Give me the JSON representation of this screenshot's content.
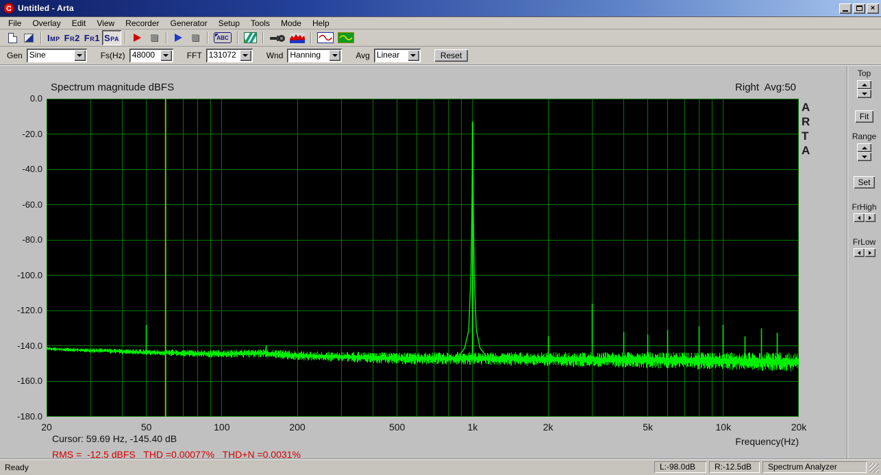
{
  "window": {
    "title": "Untitled - Arta"
  },
  "menu": {
    "items": [
      "File",
      "Overlay",
      "Edit",
      "View",
      "Recorder",
      "Generator",
      "Setup",
      "Tools",
      "Mode",
      "Help"
    ]
  },
  "toolbar": {
    "mode_buttons": [
      {
        "label": "Imp"
      },
      {
        "label": "Fr2"
      },
      {
        "label": "Fr1"
      },
      {
        "label": "Spa"
      }
    ],
    "abc_label": "ABC"
  },
  "controls": {
    "gen_label": "Gen",
    "gen_value": "Sine",
    "fs_label": "Fs(Hz)",
    "fs_value": "48000",
    "fft_label": "FFT",
    "fft_value": "131072",
    "wnd_label": "Wnd",
    "wnd_value": "Hanning",
    "avg_label": "Avg",
    "avg_value": "Linear",
    "reset_label": "Reset"
  },
  "graph": {
    "title": "Spectrum magnitude dBFS",
    "channel_avg": "Right  Avg:50",
    "watermark": "ARTA",
    "xlabel": "Frequency(Hz)",
    "cursor_readout": "Cursor: 59.69 Hz, -145.40 dB",
    "measurement_readout": "RMS =  -12.5 dBFS   THD =0.00077%   THD+N =0.0031%"
  },
  "side_panel": {
    "top": "Top",
    "fit": "Fit",
    "range": "Range",
    "set": "Set",
    "fr_high": "FrHigh",
    "fr_low": "FrLow"
  },
  "status_bar": {
    "ready": "Ready",
    "left_level": "L:-98.0dB",
    "right_level": "R:-12.5dB",
    "mode": "Spectrum Analyzer"
  },
  "chart_data": {
    "type": "line",
    "title": "Spectrum magnitude dBFS",
    "xlabel": "Frequency(Hz)",
    "ylabel": "dBFS",
    "x_scale": "log",
    "x_range": [
      20,
      20000
    ],
    "y_range": [
      -180,
      0
    ],
    "grid": true,
    "x_ticks": [
      {
        "f": 20,
        "label": "20"
      },
      {
        "f": 50,
        "label": "50"
      },
      {
        "f": 100,
        "label": "100"
      },
      {
        "f": 200,
        "label": "200"
      },
      {
        "f": 500,
        "label": "500"
      },
      {
        "f": 1000,
        "label": "1k"
      },
      {
        "f": 2000,
        "label": "2k"
      },
      {
        "f": 5000,
        "label": "5k"
      },
      {
        "f": 10000,
        "label": "10k"
      },
      {
        "f": 20000,
        "label": "20k"
      }
    ],
    "y_ticks": [
      {
        "v": 0,
        "label": "0.0"
      },
      {
        "v": -20,
        "label": "-20.0"
      },
      {
        "v": -40,
        "label": "-40.0"
      },
      {
        "v": -60,
        "label": "-60.0"
      },
      {
        "v": -80,
        "label": "-80.0"
      },
      {
        "v": -100,
        "label": "-100.0"
      },
      {
        "v": -120,
        "label": "-120.0"
      },
      {
        "v": -140,
        "label": "-140.0"
      },
      {
        "v": -160,
        "label": "-160.0"
      },
      {
        "v": -180,
        "label": "-180.0"
      }
    ],
    "cursor": {
      "freq_hz": 59.69,
      "level_dbfs": -145.4
    },
    "fundamental": {
      "freq_hz": 1000,
      "level_dbfs": -13
    },
    "harmonics_spurs": [
      {
        "f": 50,
        "db": -128
      },
      {
        "f": 150,
        "db": -139.5
      },
      {
        "f": 2000,
        "db": -134.5
      },
      {
        "f": 3000,
        "db": -116
      },
      {
        "f": 4000,
        "db": -132
      },
      {
        "f": 5000,
        "db": -133.5
      },
      {
        "f": 6000,
        "db": -131
      },
      {
        "f": 8000,
        "db": -129
      },
      {
        "f": 10000,
        "db": -128
      },
      {
        "f": 12200,
        "db": -134.5
      },
      {
        "f": 14200,
        "db": -130
      },
      {
        "f": 16400,
        "db": -132.5
      }
    ],
    "noise_floor_db": [
      [
        20,
        -141.5
      ],
      [
        30,
        -142.5
      ],
      [
        50,
        -143.5
      ],
      [
        100,
        -144.5
      ],
      [
        150,
        -144
      ],
      [
        200,
        -145.5
      ],
      [
        300,
        -146
      ],
      [
        500,
        -147
      ],
      [
        1000,
        -147
      ],
      [
        2000,
        -147.5
      ],
      [
        5000,
        -148
      ],
      [
        10000,
        -148.5
      ],
      [
        20000,
        -149
      ]
    ],
    "noise_band_halfwidth_db": [
      [
        20,
        0.9
      ],
      [
        100,
        2.0
      ],
      [
        500,
        3.0
      ],
      [
        2000,
        3.6
      ],
      [
        20000,
        5.0
      ]
    ],
    "stats": {
      "rms_dbfs": -12.5,
      "thd_pct": 0.00077,
      "thd_n_pct": 0.0031
    },
    "colors": {
      "trace": "#00f000",
      "grid": "#007a00",
      "cursor_line": "#b8b800",
      "plot_bg": "#000000",
      "readout_red": "#d40000"
    }
  }
}
